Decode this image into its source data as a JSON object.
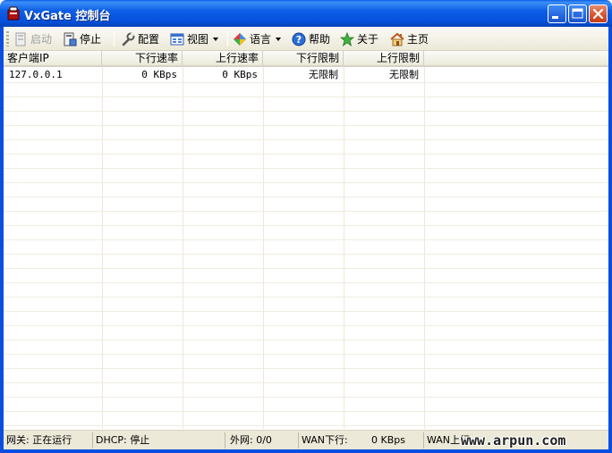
{
  "window": {
    "title": "VxGate 控制台"
  },
  "toolbar": {
    "items": [
      {
        "label": "启动",
        "icon": "start-icon",
        "disabled": true
      },
      {
        "label": "停止",
        "icon": "stop-icon",
        "disabled": false
      },
      {
        "label": "配置",
        "icon": "wrench-icon",
        "disabled": false
      },
      {
        "label": "视图",
        "icon": "view-icon",
        "disabled": false
      },
      {
        "label": "语言",
        "icon": "language-icon",
        "disabled": false
      },
      {
        "label": "帮助",
        "icon": "help-icon",
        "disabled": false
      },
      {
        "label": "关于",
        "icon": "star-icon",
        "disabled": false
      },
      {
        "label": "主页",
        "icon": "home-icon",
        "disabled": false
      }
    ]
  },
  "table": {
    "columns": [
      "客户端IP",
      "下行速率",
      "上行速率",
      "下行限制",
      "上行限制"
    ],
    "rows": [
      {
        "ip": "127.0.0.1",
        "down_rate": "0 KBps",
        "up_rate": "0 KBps",
        "down_limit": "无限制",
        "up_limit": "无限制"
      }
    ]
  },
  "statusbar": {
    "gateway": "网关: 正在运行",
    "dhcp": "DHCP: 停止",
    "wan_ip": "外网: 0/0",
    "wan_down_label": "WAN下行:",
    "wan_down_value": "0 KBps",
    "wan_up_label": "WAN上行"
  },
  "watermark": "www.arpun.com",
  "colors": {
    "title_bar": "#0550dc",
    "toolbar_bg": "#ece9d8",
    "close_button": "#d9562f"
  }
}
